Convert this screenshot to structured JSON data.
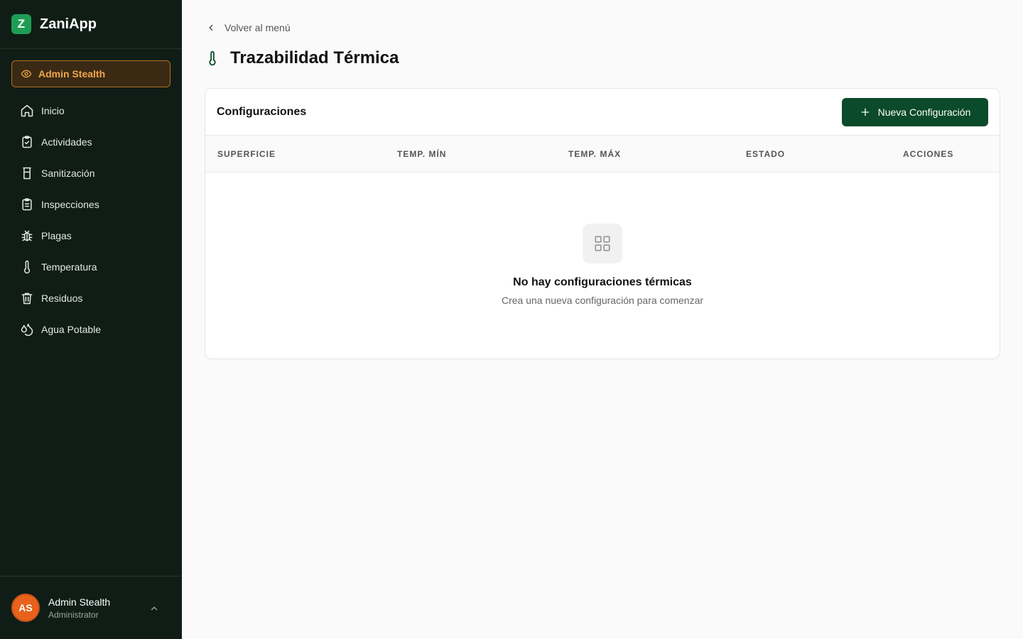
{
  "brand": {
    "logo_letter": "Z",
    "name": "ZaniApp",
    "color": "#1f9d55"
  },
  "stealth_badge": {
    "label": "Admin Stealth",
    "icon": "eye-icon",
    "color": "#f3a54a"
  },
  "nav": [
    {
      "label": "Inicio",
      "icon": "home-icon"
    },
    {
      "label": "Actividades",
      "icon": "clipboard-check-icon"
    },
    {
      "label": "Sanitización",
      "icon": "glass-icon"
    },
    {
      "label": "Inspecciones",
      "icon": "clipboard-list-icon"
    },
    {
      "label": "Plagas",
      "icon": "bug-icon"
    },
    {
      "label": "Temperatura",
      "icon": "thermometer-icon"
    },
    {
      "label": "Residuos",
      "icon": "trash-icon"
    },
    {
      "label": "Agua Potable",
      "icon": "droplets-icon"
    }
  ],
  "user": {
    "initials": "AS",
    "name": "Admin Stealth",
    "role": "Administrator",
    "avatar_color": "#e8621b"
  },
  "back_link": {
    "label": "Volver al menú",
    "icon": "chevron-left-icon"
  },
  "page": {
    "title": "Trazabilidad Térmica",
    "icon": "thermometer-icon",
    "accent": "#0b4a2a"
  },
  "card": {
    "title": "Configuraciones",
    "new_button": "Nueva Configuración",
    "columns": [
      "SUPERFICIE",
      "TEMP. MÍN",
      "TEMP. MÁX",
      "ESTADO",
      "ACCIONES"
    ],
    "empty_title": "No hay configuraciones térmicas",
    "empty_subtitle": "Crea una nueva configuración para comenzar",
    "empty_icon": "grid-icon"
  }
}
